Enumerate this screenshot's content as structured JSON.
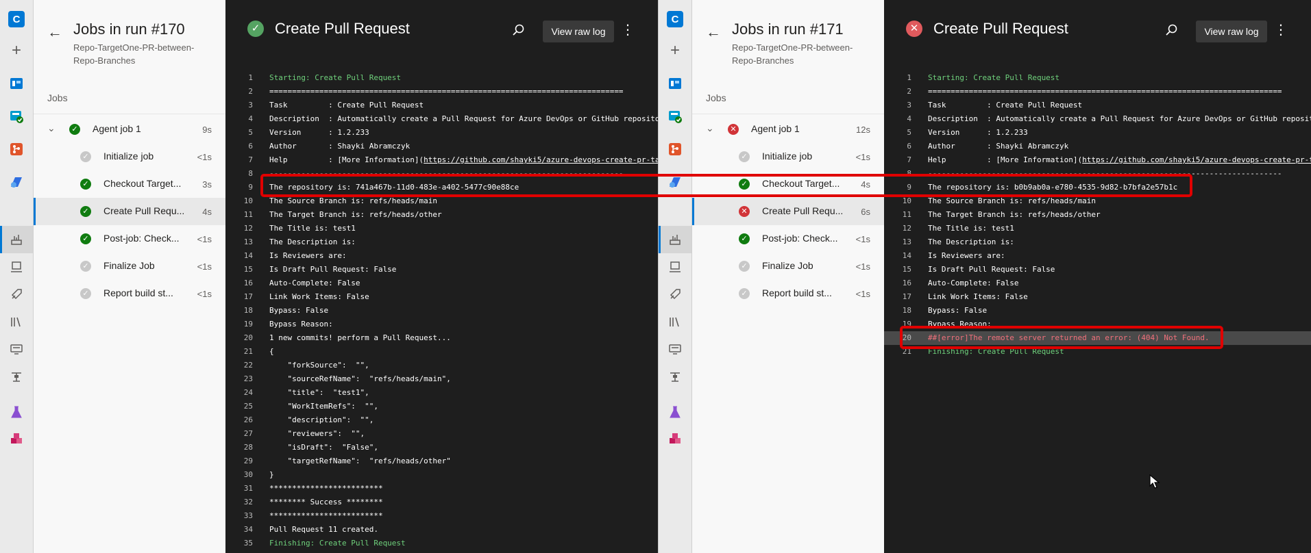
{
  "rail_icons": [
    "org-icon",
    "plus-icon",
    "boards-icon",
    "repos-icon",
    "git-icon",
    "pipelines-icon",
    "builds-icon",
    "environments-icon",
    "releases-icon",
    "library-icon",
    "task-groups-icon",
    "deployment-groups-icon",
    "test-plans-icon",
    "artifacts-icon"
  ],
  "panels": [
    {
      "org_letter": "C",
      "title": "Jobs in run #170",
      "subtitle": "Repo-TargetOne-PR-between-Repo-Branches",
      "jobs_heading": "Jobs",
      "agent_job": {
        "label": "Agent job 1",
        "duration": "9s",
        "status": "success"
      },
      "steps": [
        {
          "label": "Initialize job",
          "duration": "<1s",
          "status": "skipped"
        },
        {
          "label": "Checkout Target...",
          "duration": "3s",
          "status": "success"
        },
        {
          "label": "Create Pull Requ...",
          "duration": "4s",
          "status": "success"
        },
        {
          "label": "Post-job: Check...",
          "duration": "<1s",
          "status": "success"
        },
        {
          "label": "Finalize Job",
          "duration": "<1s",
          "status": "skipped"
        },
        {
          "label": "Report build st...",
          "duration": "<1s",
          "status": "skipped"
        }
      ],
      "log": {
        "title": "Create Pull Request",
        "status": "success",
        "view_raw_label": "View raw log",
        "lines": [
          {
            "n": "1",
            "t": "Starting: Create Pull Request",
            "style": "green"
          },
          {
            "n": "2",
            "t": "==============================================================================",
            "style": ""
          },
          {
            "n": "3",
            "t": "Task         : Create Pull Request",
            "style": ""
          },
          {
            "n": "4",
            "t": "Description  : Automatically create a Pull Request for Azure DevOps or GitHub reposito",
            "style": ""
          },
          {
            "n": "5",
            "t": "Version      : 1.2.233",
            "style": ""
          },
          {
            "n": "6",
            "t": "Author       : Shayki Abramczyk",
            "style": ""
          },
          {
            "n": "7",
            "t": "Help         : [More Information](https://github.com/shayki5/azure-devops-create-pr-ta",
            "style": ""
          },
          {
            "n": "8",
            "t": "------------------------------------------------------------------------------",
            "style": ""
          },
          {
            "n": "9",
            "t": "The repository is: 741a467b-11d0-483e-a402-5477c90e88ce",
            "style": ""
          },
          {
            "n": "10",
            "t": "The Source Branch is: refs/heads/main",
            "style": ""
          },
          {
            "n": "11",
            "t": "The Target Branch is: refs/heads/other",
            "style": ""
          },
          {
            "n": "12",
            "t": "The Title is: test1",
            "style": ""
          },
          {
            "n": "13",
            "t": "The Description is:",
            "style": ""
          },
          {
            "n": "14",
            "t": "Is Reviewers are:",
            "style": ""
          },
          {
            "n": "15",
            "t": "Is Draft Pull Request: False",
            "style": ""
          },
          {
            "n": "16",
            "t": "Auto-Complete: False",
            "style": ""
          },
          {
            "n": "17",
            "t": "Link Work Items: False",
            "style": ""
          },
          {
            "n": "18",
            "t": "Bypass: False",
            "style": ""
          },
          {
            "n": "19",
            "t": "Bypass Reason:",
            "style": ""
          },
          {
            "n": "20",
            "t": "1 new commits! perform a Pull Request...",
            "style": ""
          },
          {
            "n": "21",
            "t": "{",
            "style": ""
          },
          {
            "n": "22",
            "t": "    \"forkSource\":  \"\",",
            "style": ""
          },
          {
            "n": "23",
            "t": "    \"sourceRefName\":  \"refs/heads/main\",",
            "style": ""
          },
          {
            "n": "24",
            "t": "    \"title\":  \"test1\",",
            "style": ""
          },
          {
            "n": "25",
            "t": "    \"WorkItemRefs\":  \"\",",
            "style": ""
          },
          {
            "n": "26",
            "t": "    \"description\":  \"\",",
            "style": ""
          },
          {
            "n": "27",
            "t": "    \"reviewers\":  \"\",",
            "style": ""
          },
          {
            "n": "28",
            "t": "    \"isDraft\":  \"False\",",
            "style": ""
          },
          {
            "n": "29",
            "t": "    \"targetRefName\":  \"refs/heads/other\"",
            "style": ""
          },
          {
            "n": "30",
            "t": "}",
            "style": ""
          },
          {
            "n": "31",
            "t": "*************************",
            "style": ""
          },
          {
            "n": "32",
            "t": "******** Success ********",
            "style": ""
          },
          {
            "n": "33",
            "t": "*************************",
            "style": ""
          },
          {
            "n": "34",
            "t": "Pull Request 11 created.",
            "style": ""
          },
          {
            "n": "35",
            "t": "Finishing: Create Pull Request",
            "style": "green"
          }
        ]
      }
    },
    {
      "org_letter": "C",
      "title": "Jobs in run #171",
      "subtitle": "Repo-TargetOne-PR-between-Repo-Branches",
      "jobs_heading": "Jobs",
      "agent_job": {
        "label": "Agent job 1",
        "duration": "12s",
        "status": "failed"
      },
      "steps": [
        {
          "label": "Initialize job",
          "duration": "<1s",
          "status": "skipped"
        },
        {
          "label": "Checkout Target...",
          "duration": "4s",
          "status": "success"
        },
        {
          "label": "Create Pull Requ...",
          "duration": "6s",
          "status": "failed"
        },
        {
          "label": "Post-job: Check...",
          "duration": "<1s",
          "status": "success"
        },
        {
          "label": "Finalize Job",
          "duration": "<1s",
          "status": "skipped"
        },
        {
          "label": "Report build st...",
          "duration": "<1s",
          "status": "skipped"
        }
      ],
      "log": {
        "title": "Create Pull Request",
        "status": "failed",
        "view_raw_label": "View raw log",
        "lines": [
          {
            "n": "1",
            "t": "Starting: Create Pull Request",
            "style": "green"
          },
          {
            "n": "2",
            "t": "==============================================================================",
            "style": ""
          },
          {
            "n": "3",
            "t": "Task         : Create Pull Request",
            "style": ""
          },
          {
            "n": "4",
            "t": "Description  : Automatically create a Pull Request for Azure DevOps or GitHub reposit",
            "style": ""
          },
          {
            "n": "5",
            "t": "Version      : 1.2.233",
            "style": ""
          },
          {
            "n": "6",
            "t": "Author       : Shayki Abramczyk",
            "style": ""
          },
          {
            "n": "7",
            "t": "Help         : [More Information](https://github.com/shayki5/azure-devops-create-pr-t",
            "style": ""
          },
          {
            "n": "8",
            "t": "------------------------------------------------------------------------------",
            "style": ""
          },
          {
            "n": "9",
            "t": "The repository is: b0b9ab0a-e780-4535-9d82-b7bfa2e57b1c",
            "style": ""
          },
          {
            "n": "10",
            "t": "The Source Branch is: refs/heads/main",
            "style": ""
          },
          {
            "n": "11",
            "t": "The Target Branch is: refs/heads/other",
            "style": ""
          },
          {
            "n": "12",
            "t": "The Title is: test1",
            "style": ""
          },
          {
            "n": "13",
            "t": "The Description is:",
            "style": ""
          },
          {
            "n": "14",
            "t": "Is Reviewers are:",
            "style": ""
          },
          {
            "n": "15",
            "t": "Is Draft Pull Request: False",
            "style": ""
          },
          {
            "n": "16",
            "t": "Auto-Complete: False",
            "style": ""
          },
          {
            "n": "17",
            "t": "Link Work Items: False",
            "style": ""
          },
          {
            "n": "18",
            "t": "Bypass: False",
            "style": ""
          },
          {
            "n": "19",
            "t": "Bypass Reason:",
            "style": ""
          },
          {
            "n": "20",
            "t": "##[error]The remote server returned an error: (404) Not Found.",
            "style": "err"
          },
          {
            "n": "21",
            "t": "Finishing: Create Pull Request",
            "style": "green"
          }
        ]
      }
    }
  ],
  "colors": {
    "success": "#107c10",
    "failed": "#d13438",
    "skipped": "#c8c8c8",
    "accent": "#0078d4",
    "highlight": "#e00000"
  }
}
